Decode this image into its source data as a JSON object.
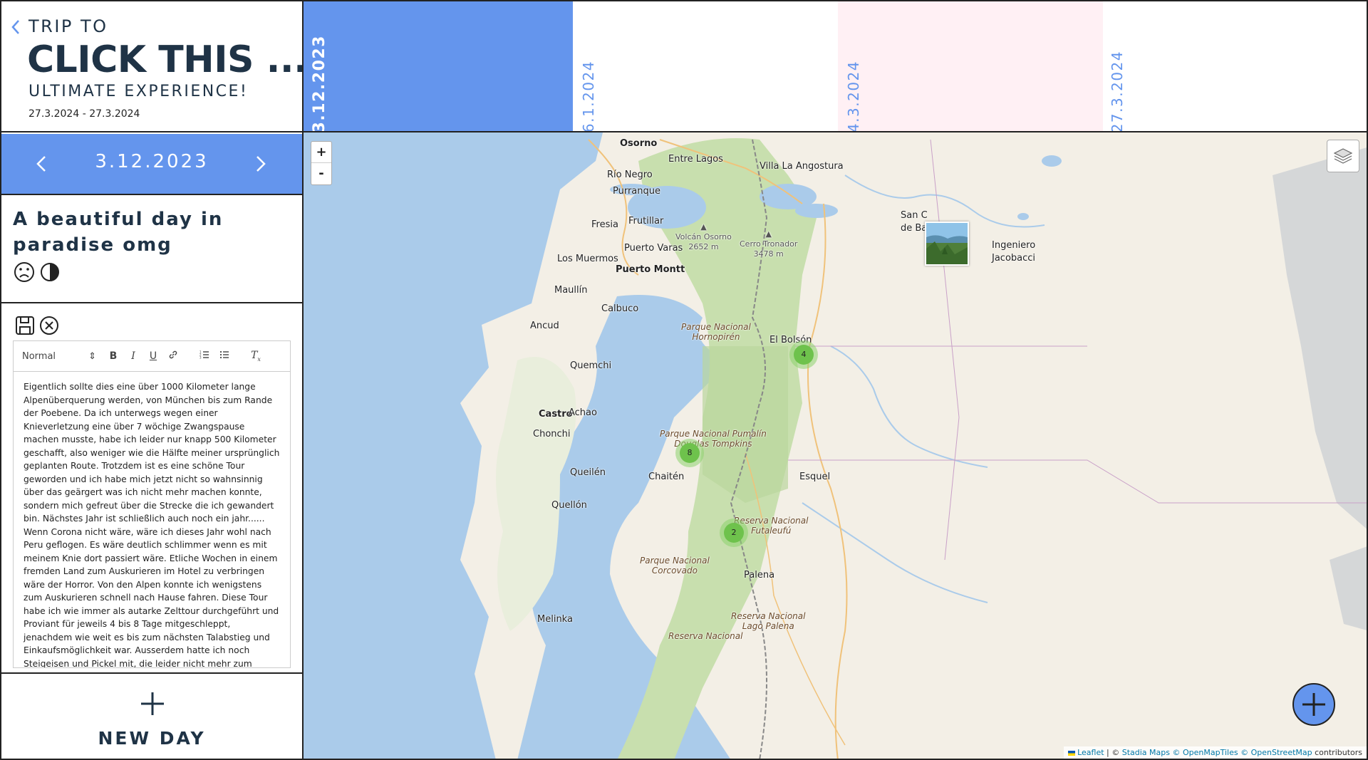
{
  "trip": {
    "label": "TRIP TO",
    "title": "CLICK THIS ...",
    "subtitle": "ULTIMATE EXPERIENCE!",
    "dates": "27.3.2024 - 27.3.2024"
  },
  "day": {
    "date": "3.12.2023",
    "headline": "A beautiful day in paradise omg",
    "moods": [
      "sad-face-icon",
      "half-moon-icon"
    ]
  },
  "editor": {
    "format_value": "Normal",
    "text": "Eigentlich sollte dies eine über 1000 Kilometer lange Alpenüberquerung werden, von München bis zum Rande der Poebene. Da ich unterwegs wegen einer Knieverletzung eine über 7 wöchige Zwangspause machen musste, habe ich leider nur knapp 500 Kilometer geschafft, also weniger wie die Hälfte meiner ursprünglich geplanten Route. Trotzdem ist es eine schöne Tour geworden und ich habe mich jetzt nicht so wahnsinnig über das geärgert was ich nicht mehr machen konnte, sondern mich gefreut über die Strecke die ich gewandert bin. Nächstes Jahr ist schließlich auch noch ein jahr...... Wenn Corona nicht wäre, wäre ich dieses Jahr wohl nach Peru geflogen. Es wäre deutlich schlimmer wenn es mit meinem Knie dort passiert wäre. Etliche Wochen in einem fremden Land zum Auskurieren im Hotel zu verbringen wäre der Horror. Von den Alpen konnte ich wenigstens zum Auskurieren schnell nach Hause fahren. Diese Tour habe ich wie immer als autarke Zelttour durchgeführt und Proviant für jeweils 4 bis 8 Tage mitgeschleppt, jenachdem wie weit es bis zum nächsten Talabstieg und Einkaufsmöglichkeit war. Ausserdem hatte ich noch Steigeisen und Pickel mit, die leider nicht mehr zum Einsatz kamen, da ich es bis zu den Gletscherregionen der"
  },
  "new_day": {
    "label": "NEW DAY"
  },
  "timeline": [
    {
      "date": "3.12.2023",
      "active": true,
      "color": "#6495ed"
    },
    {
      "date": "6.1.2024",
      "active": false,
      "color": "#ffffff"
    },
    {
      "date": "4.3.2024",
      "active": false,
      "color": "#fff0f4"
    },
    {
      "date": "27.3.2024",
      "active": false,
      "color": "#ffffff"
    }
  ],
  "map": {
    "zoom_in": "+",
    "zoom_out": "-",
    "places": {
      "osorno": "Osorno",
      "entre_lagos": "Entre Lagos",
      "villa_la_angostura": "Villa La Angostura",
      "rio_negro": "Río Negro",
      "purranque": "Purranque",
      "fresia": "Fresia",
      "frutillar": "Frutillar",
      "volcan_osorno": "Volcán Osorno",
      "volcan_osorno_alt": "2652 m",
      "cerro_tronador": "Cerro Tronador",
      "cerro_tronador_alt": "3478 m",
      "san_carlos_1": "San C",
      "san_carlos_2": "de Ba",
      "ingeniero_1": "Ingeniero",
      "ingeniero_2": "Jacobacci",
      "los_muermos": "Los Muermos",
      "puerto_varas": "Puerto Varas",
      "puerto_montt": "Puerto Montt",
      "maullin": "Maullín",
      "calbuco": "Calbuco",
      "ancud": "Ancud",
      "hornopiren_1": "Parque Nacional",
      "hornopiren_2": "Hornopirén",
      "el_bolson": "El Bolsón",
      "quemchi": "Quemchi",
      "castro": "Castro",
      "achao": "Achao",
      "chonchi": "Chonchi",
      "pumalin_1": "Parque Nacional Pumalín",
      "pumalin_2": "Douglas Tompkins",
      "queilen": "Queilén",
      "chaiten": "Chaitén",
      "esquel": "Esquel",
      "quellon": "Quellón",
      "futaleufu_1": "Reserva Nacional",
      "futaleufu_2": "Futaleufú",
      "corcovado_1": "Parque Nacional",
      "corcovado_2": "Corcovado",
      "palena": "Palena",
      "lago_palena_1": "Reserva Nacional",
      "lago_palena_2": "Lago Palena",
      "melinka": "Melinka",
      "reserva_bottom": "Reserva Nacional"
    },
    "clusters": [
      {
        "count": "4"
      },
      {
        "count": "8"
      },
      {
        "count": "2"
      }
    ],
    "attribution": {
      "leaflet": "Leaflet",
      "sep": " | © ",
      "stadia": "Stadia Maps",
      "omt": "© OpenMapTiles",
      "osm": "© OpenStreetMap",
      "contrib": " contributors"
    }
  },
  "colors": {
    "accent": "#6495ed",
    "text": "#1f3346",
    "water": "#aacbea",
    "land": "#f3efe6",
    "forest": "#c8dfae",
    "cluster": "#6ec24c"
  }
}
